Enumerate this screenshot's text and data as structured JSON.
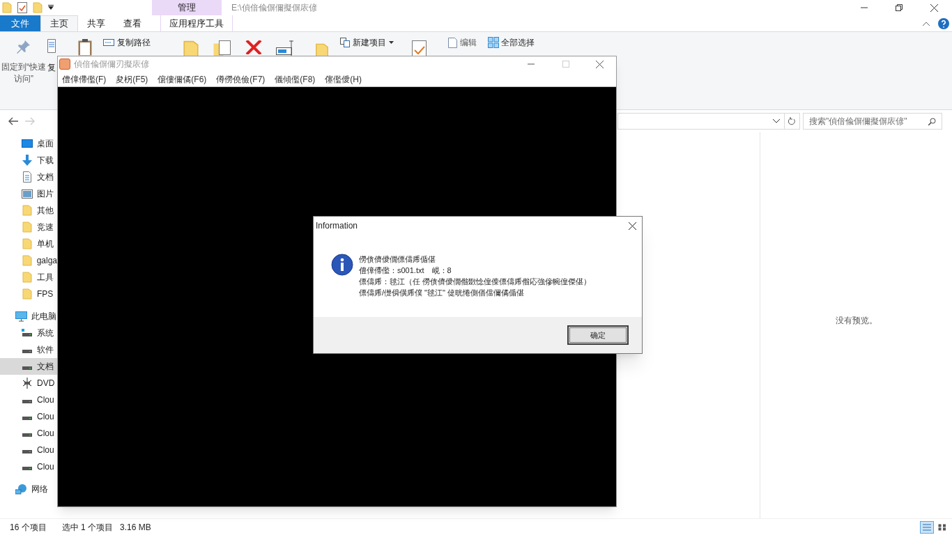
{
  "explorer": {
    "context_tab_group": "管理",
    "title": "E:\\偵偣偸偋儞擬偋庡偐",
    "tabs": [
      {
        "label": "文件",
        "kind": "file",
        "selected": false
      },
      {
        "label": "主页",
        "kind": "tab",
        "selected": true
      },
      {
        "label": "共享",
        "kind": "tab",
        "selected": false
      },
      {
        "label": "查看",
        "kind": "tab",
        "selected": false
      },
      {
        "label": "应用程序工具",
        "kind": "context",
        "selected": false
      }
    ],
    "ribbon": {
      "pin_label": "固定到“快速访问”",
      "copy_label": "复",
      "copy_path": "复制路径",
      "new_item": "新建项目",
      "edit": "编辑",
      "select_all": "全部选择"
    },
    "search": {
      "placeholder": "搜索\"偵偣偸偋儞擬偋庡偐\""
    },
    "sidebar": {
      "quick_access": [
        {
          "label": "桌面",
          "kind": "desktop",
          "selected": false
        },
        {
          "label": "下载",
          "kind": "download",
          "selected": false
        },
        {
          "label": "文档",
          "kind": "document",
          "selected": false
        },
        {
          "label": "图片",
          "kind": "picture",
          "selected": false
        },
        {
          "label": "其他",
          "kind": "folder",
          "selected": false
        },
        {
          "label": "竞速",
          "kind": "folder",
          "selected": false
        },
        {
          "label": "单机",
          "kind": "folder",
          "selected": false
        },
        {
          "label": "galga",
          "kind": "folder",
          "selected": false
        },
        {
          "label": "工具",
          "kind": "folder",
          "selected": false
        },
        {
          "label": "FPS",
          "kind": "folder",
          "selected": false
        }
      ],
      "this_pc": {
        "label": "此电脑",
        "children": [
          {
            "label": "系统",
            "kind": "system",
            "selected": false
          },
          {
            "label": "软件",
            "kind": "drive",
            "selected": false
          },
          {
            "label": "文档",
            "kind": "drive",
            "selected": true
          },
          {
            "label": "DVD",
            "kind": "dvd",
            "selected": false
          },
          {
            "label": "Clou",
            "kind": "drive",
            "selected": false
          },
          {
            "label": "Clou",
            "kind": "drive",
            "selected": false
          },
          {
            "label": "Clou",
            "kind": "drive",
            "selected": false
          },
          {
            "label": "Clou",
            "kind": "drive",
            "selected": false
          },
          {
            "label": "Clou",
            "kind": "drive",
            "selected": false
          }
        ]
      },
      "network": "网络"
    },
    "preview_text": "没有预览。",
    "status_bar": {
      "item_count": "16 个项目",
      "selection": "选中 1 个项目",
      "size": "3.16 MB"
    }
  },
  "app_window": {
    "title": "偵偣偸偋儞刃擬庡偐",
    "menu": [
      "僼傽僀儖(F)",
      "夋柺(F5)",
      "僒僂儞僪(F6)",
      "僔僗僥儉(F7)",
      "儀傾儖(F8)",
      "僿儖僾(H)"
    ]
  },
  "dialog": {
    "title": "Information",
    "lines": [
      "僗僋儕僾僩僄儔乕偱偡",
      "僼傽僀儖：s001.txt　峴：8",
      "僄儔乕：毬江（任 僗僋儕僾僩偺敪惗偟偨僄儔乕偺応強傪帵偟傑偡）",
      "僄儔乕/儊僢僙乕僕 \"毬江\" 偼晄惓側僐儅儞僪偱偡"
    ],
    "button": "确定"
  }
}
